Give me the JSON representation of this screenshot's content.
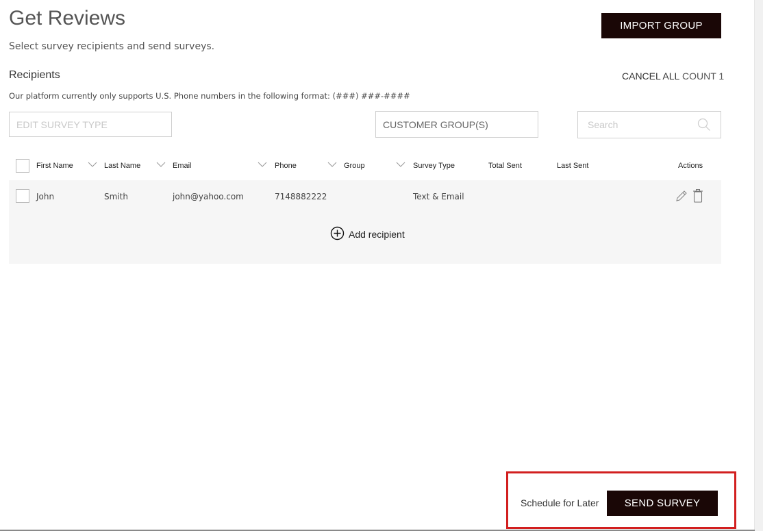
{
  "header": {
    "title": "Get Reviews",
    "subtitle": "Select survey recipients and send surveys.",
    "import_group_label": "IMPORT GROUP"
  },
  "recipients": {
    "label": "Recipients",
    "cancel_all_label": "CANCEL ALL",
    "count_label": "COUNT 1",
    "phone_note": "Our platform currently only supports U.S. Phone numbers in the following format: (###) ###-####"
  },
  "filters": {
    "survey_type_placeholder": "EDIT SURVEY TYPE",
    "customer_group_label": "CUSTOMER GROUP(S)",
    "search_placeholder": "Search"
  },
  "table": {
    "columns": [
      "First Name",
      "Last Name",
      "Email",
      "Phone",
      "Group",
      "Survey Type",
      "Total Sent",
      "Last Sent",
      "Actions"
    ],
    "rows": [
      {
        "first_name": "John",
        "last_name": "Smith",
        "email": "john@yahoo.com",
        "phone": "7148882222",
        "group": "",
        "survey_type": "Text & Email",
        "total_sent": "",
        "last_sent": ""
      }
    ],
    "add_recipient_label": "Add recipient"
  },
  "footer": {
    "schedule_label": "Schedule for Later",
    "send_label": "SEND SURVEY"
  },
  "colors": {
    "primary_button": "#1a0706",
    "highlight": "#d21f1f"
  },
  "icons": [
    "search-icon",
    "chevron-down-icon",
    "pencil-icon",
    "trash-icon",
    "plus-circle-icon"
  ]
}
